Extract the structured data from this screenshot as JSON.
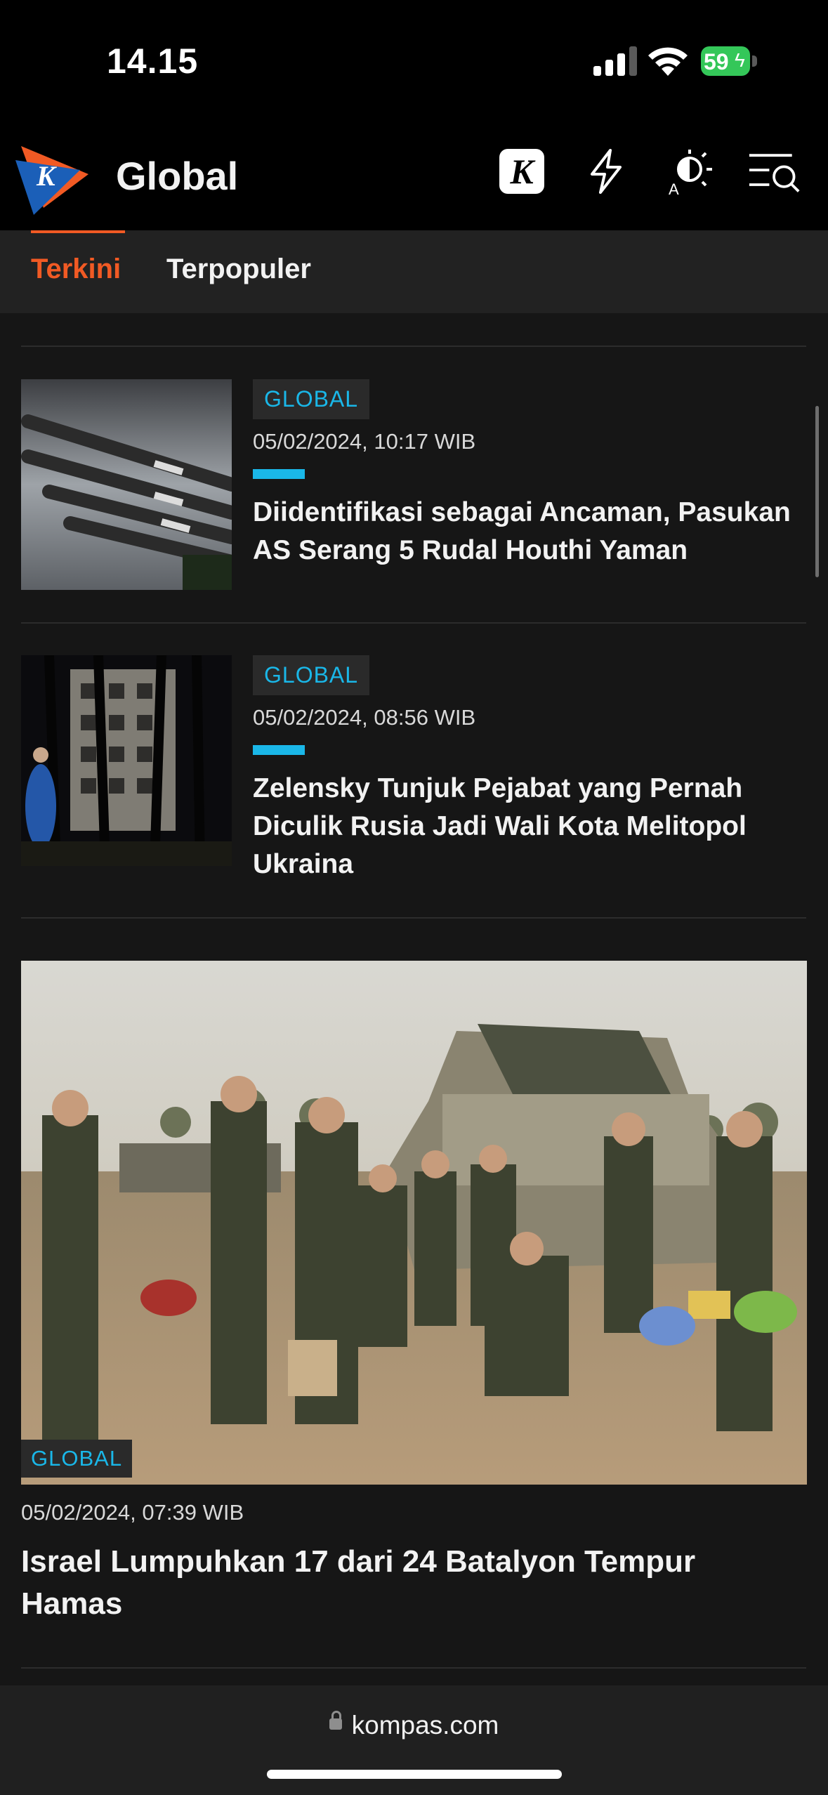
{
  "status_bar": {
    "time": "14.15",
    "battery": "59"
  },
  "header": {
    "title": "Global"
  },
  "tabs": [
    {
      "label": "Terkini",
      "active": true
    },
    {
      "label": "Terpopuler",
      "active": false
    }
  ],
  "articles": [
    {
      "category": "GLOBAL",
      "date": "05/02/2024, 10:17 WIB",
      "title_lines": [
        "Diidentifikasi sebagai Ancaman, Pasukan",
        "AS Serang 5 Rudal Houthi Yaman"
      ]
    },
    {
      "category": "GLOBAL",
      "date": "05/02/2024, 08:56 WIB",
      "title_lines": [
        "Zelensky Tunjuk Pejabat yang Pernah",
        "Diculik Rusia Jadi Wali Kota Melitopol",
        "Ukraina"
      ]
    },
    {
      "category": "GLOBAL",
      "date": "05/02/2024, 07:39 WIB",
      "title_lines": [
        "Israel Lumpuhkan 17 dari 24 Batalyon Tempur",
        "Hamas"
      ]
    }
  ],
  "browser": {
    "url": "kompas.com"
  },
  "colors": {
    "accent_orange": "#f15a24",
    "category_blue": "#1ab7e8",
    "background": "#161616"
  },
  "icons": [
    "kompas-logo",
    "kompas-k-icon",
    "lightning-icon",
    "theme-toggle-icon",
    "menu-search-icon",
    "lock-icon"
  ]
}
